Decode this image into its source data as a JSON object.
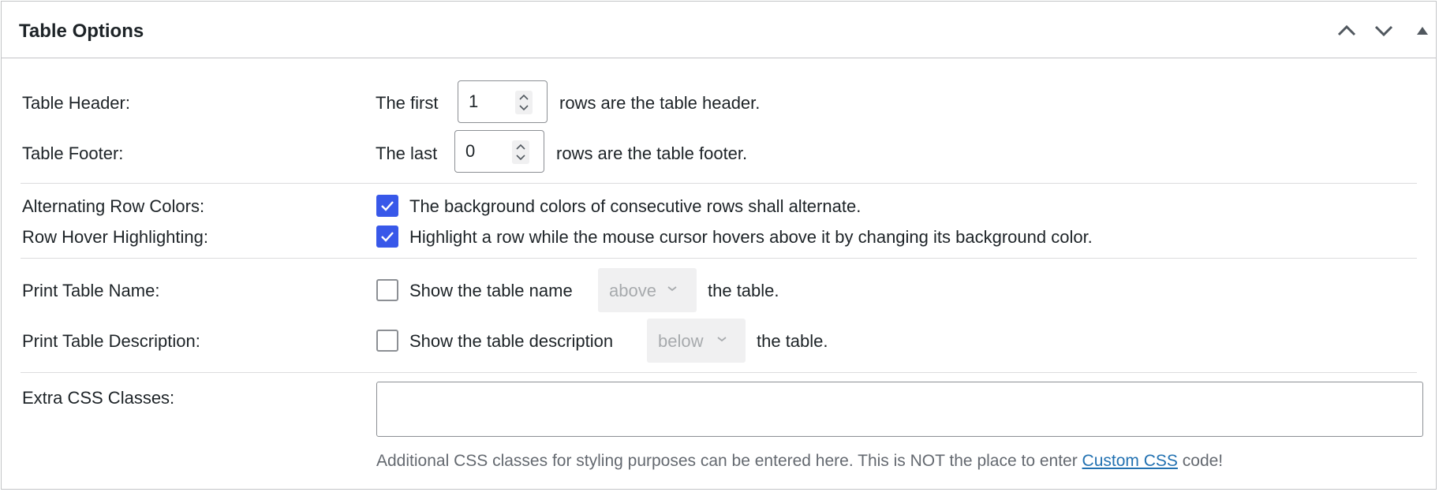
{
  "panel": {
    "title": "Table Options",
    "controls": [
      {
        "name": "move-up-icon",
        "label": "Move up"
      },
      {
        "name": "move-down-icon",
        "label": "Move down"
      },
      {
        "name": "toggle-panel-icon",
        "label": "Toggle panel"
      }
    ]
  },
  "table_header": {
    "label": "Table Header:",
    "prefix": "The first",
    "value": "1",
    "suffix": "rows are the table header."
  },
  "table_footer": {
    "label": "Table Footer:",
    "prefix": "The last",
    "value": "0",
    "suffix": "rows are the table footer."
  },
  "alternating_rows": {
    "label": "Alternating Row Colors:",
    "checked": true,
    "description": "The background colors of consecutive rows shall alternate."
  },
  "row_hover": {
    "label": "Row Hover Highlighting:",
    "checked": true,
    "description": "Highlight a row while the mouse cursor hovers above it by changing its background color."
  },
  "print_name": {
    "label": "Print Table Name:",
    "checked": false,
    "prefix": "Show the table name",
    "select_value": "above",
    "suffix": "the table."
  },
  "print_description": {
    "label": "Print Table Description:",
    "checked": false,
    "prefix": "Show the table description",
    "select_value": "below",
    "suffix": "the table."
  },
  "extra_css": {
    "label": "Extra CSS Classes:",
    "value": "",
    "help_text": "Additional CSS classes for styling purposes can be entered here. This is NOT the place to enter",
    "help_link": "Custom CSS",
    "help_suffix": "code!"
  },
  "colors": {
    "accent": "#3858e9",
    "link": "#2271b1",
    "border": "#c3c4c7"
  }
}
